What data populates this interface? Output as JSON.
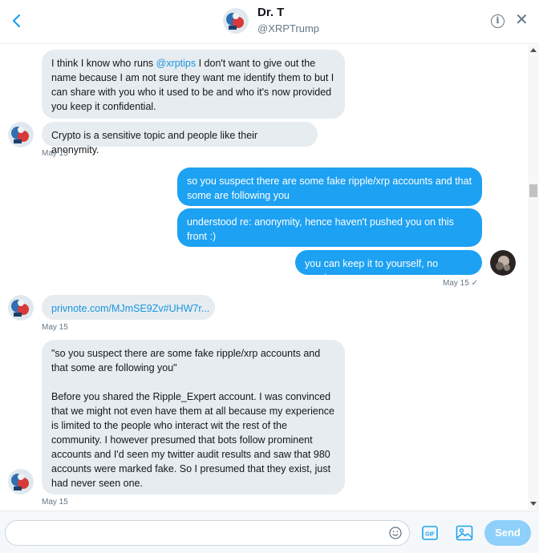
{
  "header": {
    "name": "Dr. T",
    "handle": "@XRPTrump",
    "back_icon": "back-chevron-icon",
    "info_icon": "info-icon",
    "close_icon": "close-icon"
  },
  "messages": [
    {
      "from": "them",
      "before": "I think I know who runs ",
      "link": "@xrptips",
      "after": " I don't want to give out the name because I am not sure they want me identify them to but I can share with you who it used to be and who it's now provided you keep it confidential."
    },
    {
      "from": "them",
      "text": "Crypto is a sensitive topic and people like their anonymity."
    },
    {
      "from": "them",
      "timestamp": "May 15"
    },
    {
      "from": "me",
      "text": "so you suspect there are some fake ripple/xrp accounts and that some are following you"
    },
    {
      "from": "me",
      "text": "understood re: anonymity, hence haven't pushed you on this front :)"
    },
    {
      "from": "me",
      "text": "you can keep it to yourself, no worries"
    },
    {
      "from": "me",
      "timestamp": "May 15",
      "check": "✓"
    },
    {
      "from": "them",
      "link": "privnote.com/MJmSE9Zv#UHW7r..."
    },
    {
      "from": "them",
      "timestamp": "May 15"
    },
    {
      "from": "them",
      "text": "\"so you suspect there are some fake ripple/xrp accounts and that some are following you\"\n\nBefore you shared the Ripple_Expert account. I was convinced that we might not even have them at all because my experience is limited to the people who interact wit the rest of the community. I however presumed that bots follow prominent accounts and I'd seen my twitter audit results and saw that 980 accounts were marked fake. So I presumed that they exist, just had never seen one."
    },
    {
      "from": "them",
      "timestamp": "May 15"
    }
  ],
  "composer": {
    "placeholder": "",
    "emoji_icon": "emoji-icon",
    "gif_label": "GIF",
    "image_icon": "image-icon",
    "send_label": "Send"
  },
  "colors": {
    "accent": "#1da1f2",
    "sent_bubble": "#1da1f2",
    "received_bubble": "#e6ecf0",
    "send_disabled": "#8ed0f9",
    "secondary_text": "#657786"
  }
}
